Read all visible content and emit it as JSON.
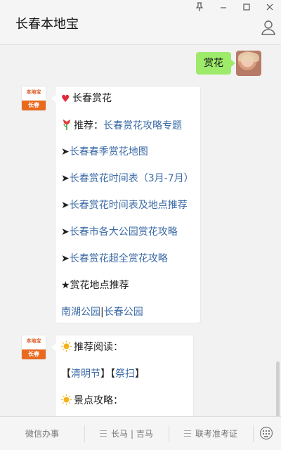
{
  "window": {
    "title": "长春本地宝",
    "controls": [
      "pin-icon",
      "minimize-icon",
      "maximize-icon",
      "close-icon"
    ]
  },
  "user_message": {
    "text": "赏花"
  },
  "account": {
    "avatar_top": "本地宝",
    "avatar_bottom": "长春"
  },
  "message1": {
    "heading": "长春赏花",
    "recommend_prefix": "推荐：",
    "recommend_link": "长春赏花攻略专题",
    "arrow": "➤",
    "links": [
      "长春春季赏花地图",
      "长春赏花时间表（3月-7月）",
      "长春赏花时间表及地点推荐",
      "长春市各大公园赏花攻略",
      "长春赏花超全赏花攻略"
    ],
    "places_heading": "★赏花地点推荐",
    "parks": [
      "南湖公园",
      "长春公园"
    ],
    "park_separator": "|"
  },
  "message2": {
    "reading_label": "推荐阅读：",
    "tags_open": "【",
    "tags_close": "】",
    "tags": [
      "清明节",
      "祭扫"
    ],
    "guide_label": "景点攻略："
  },
  "menu": {
    "items": [
      "微信办事",
      "长马 | 吉马",
      "联考准考证"
    ]
  },
  "colors": {
    "link": "#3b6aa6",
    "user_bubble": "#9eea6a",
    "brand_orange": "#e96a1f"
  }
}
